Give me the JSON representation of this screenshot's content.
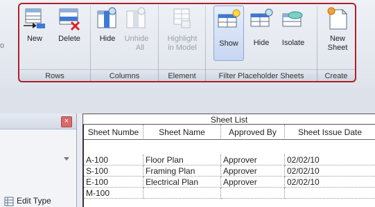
{
  "ribbon": {
    "left_stub": "o",
    "panels": {
      "rows": {
        "title": "Rows",
        "new_label": "New",
        "delete_label": "Delete"
      },
      "columns": {
        "title": "Columns",
        "hide_label": "Hide",
        "unhide_label": [
          "Unhide",
          "All"
        ]
      },
      "element": {
        "title": "Element",
        "highlight_label": [
          "Highlight",
          "in Model"
        ]
      },
      "filter": {
        "title": "Filter Placeholder Sheets",
        "show_label": "Show",
        "hide_label": "Hide",
        "isolate_label": "Isolate"
      },
      "create": {
        "title": "Create",
        "new_sheet_label": [
          "New",
          "Sheet"
        ]
      }
    },
    "colors": {
      "highlight_border": "#b01e2a",
      "pressed_bg": "#c6d6f2"
    }
  },
  "properties": {
    "close_glyph": "×",
    "edit_type_label": "Edit Type"
  },
  "schedule": {
    "title": "Sheet List",
    "headers": [
      "Sheet Numbe",
      "Sheet Name",
      "Approved By",
      "Sheet Issue Date"
    ],
    "rows": [
      [
        "A-100",
        "Floor Plan",
        "Approver",
        "02/02/10"
      ],
      [
        "S-100",
        "Framing Plan",
        "Approver",
        "02/02/10"
      ],
      [
        "E-100",
        "Electrical Plan",
        "Approver",
        "02/02/10"
      ],
      [
        "M-100",
        "",
        "",
        ""
      ]
    ]
  }
}
